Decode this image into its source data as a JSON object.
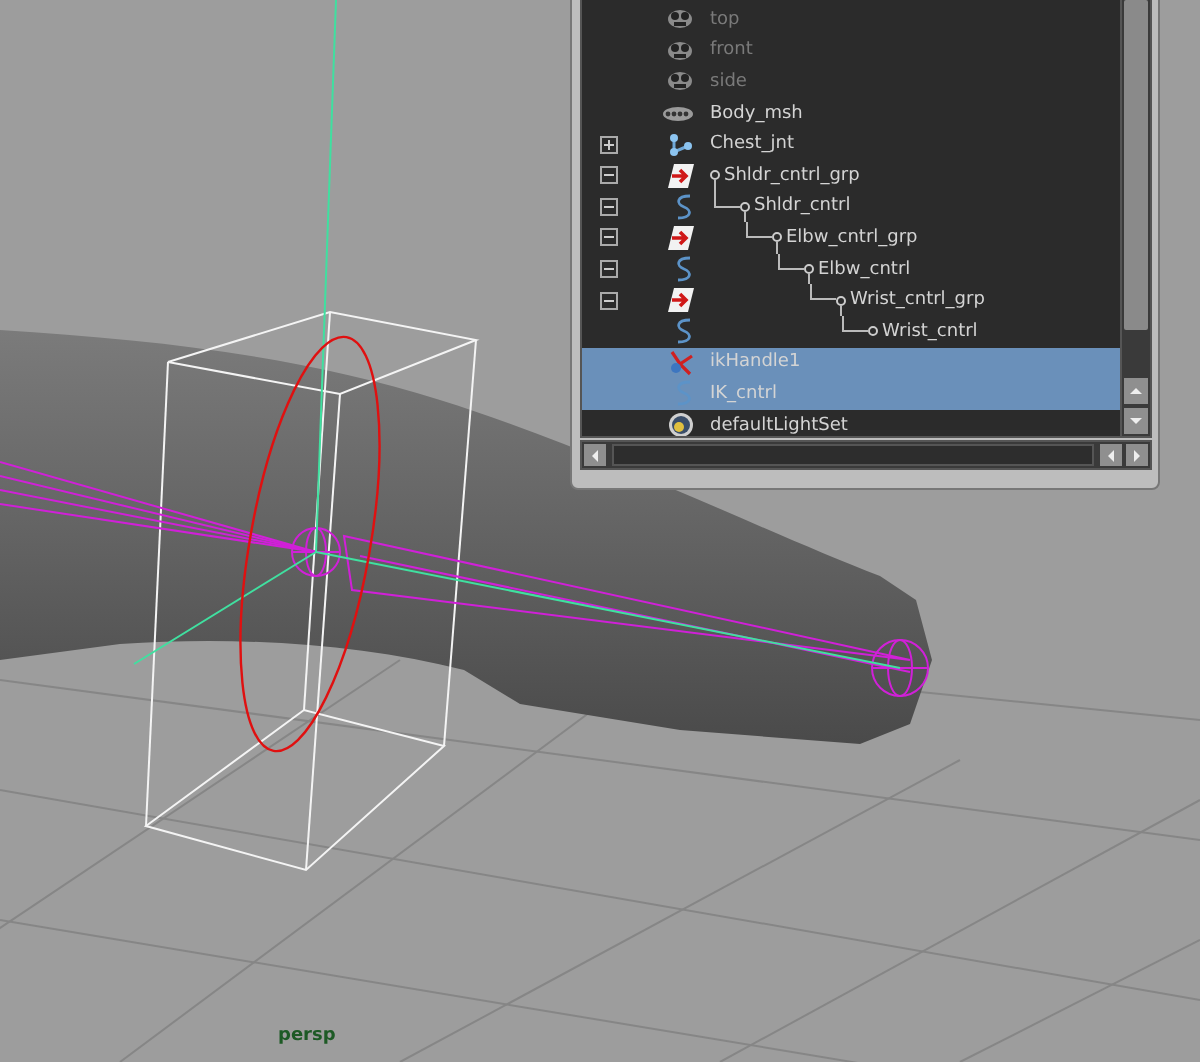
{
  "viewport": {
    "camera_label": "persp"
  },
  "outliner": {
    "items": [
      {
        "name": "top",
        "kind": "camera",
        "dimmed": true,
        "selected": false,
        "expandable": false
      },
      {
        "name": "front",
        "kind": "camera",
        "dimmed": true,
        "selected": false,
        "expandable": false
      },
      {
        "name": "side",
        "kind": "camera",
        "dimmed": true,
        "selected": false,
        "expandable": false
      },
      {
        "name": "Body_msh",
        "kind": "mesh",
        "dimmed": false,
        "selected": false,
        "expandable": false
      },
      {
        "name": "Chest_jnt",
        "kind": "joint",
        "dimmed": false,
        "selected": false,
        "expandable": true,
        "expanded": false
      },
      {
        "name": "Shldr_cntrl_grp",
        "kind": "group",
        "dimmed": false,
        "selected": false,
        "expandable": true,
        "expanded": true,
        "children": [
          {
            "name": "Shldr_cntrl",
            "kind": "curve",
            "dimmed": false,
            "selected": false,
            "expandable": true,
            "expanded": true,
            "children": [
              {
                "name": "Elbw_cntrl_grp",
                "kind": "group",
                "dimmed": false,
                "selected": false,
                "expandable": true,
                "expanded": true,
                "children": [
                  {
                    "name": "Elbw_cntrl",
                    "kind": "curve",
                    "dimmed": false,
                    "selected": false,
                    "expandable": true,
                    "expanded": true,
                    "children": [
                      {
                        "name": "Wrist_cntrl_grp",
                        "kind": "group",
                        "dimmed": false,
                        "selected": false,
                        "expandable": true,
                        "expanded": true,
                        "children": [
                          {
                            "name": "Wrist_cntrl",
                            "kind": "curve",
                            "dimmed": false,
                            "selected": false,
                            "expandable": false
                          }
                        ]
                      }
                    ]
                  }
                ]
              }
            ]
          }
        ]
      },
      {
        "name": "ikHandle1",
        "kind": "ik",
        "dimmed": false,
        "selected": true,
        "expandable": false
      },
      {
        "name": "IK_cntrl",
        "kind": "curve",
        "dimmed": false,
        "selected": true,
        "expandable": false
      },
      {
        "name": "defaultLightSet",
        "kind": "lightset",
        "dimmed": false,
        "selected": false,
        "expandable": false
      }
    ]
  }
}
